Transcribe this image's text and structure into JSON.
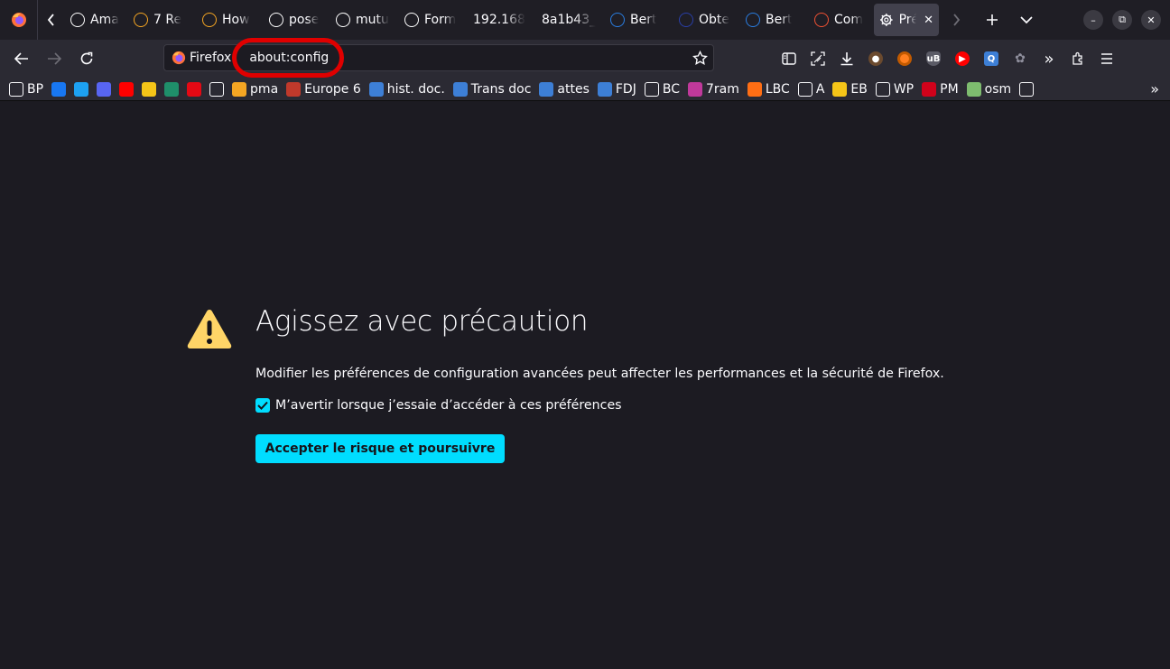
{
  "tabs": [
    {
      "label": "Ama",
      "icon": "amazon-icon",
      "color": "#ffffff"
    },
    {
      "label": "7 Re",
      "icon": "crown-icon",
      "color": "#f5a623"
    },
    {
      "label": "How",
      "icon": "crown-icon",
      "color": "#f5a623"
    },
    {
      "label": "pose",
      "icon": "wiktionary-icon",
      "color": "#ffffff"
    },
    {
      "label": "mutu",
      "icon": "wiktionary-icon",
      "color": "#ffffff"
    },
    {
      "label": "Form",
      "icon": "marianne-icon",
      "color": "#ffffff"
    },
    {
      "label": "192.168",
      "icon": "",
      "color": ""
    },
    {
      "label": "8a1b43_",
      "icon": "",
      "color": ""
    },
    {
      "label": "Bert",
      "icon": "bp-icon",
      "color": "#2a7de1"
    },
    {
      "label": "Obte",
      "icon": "circle-icon",
      "color": "#2a3fa8"
    },
    {
      "label": "Bert",
      "icon": "bp-icon",
      "color": "#2a7de1"
    },
    {
      "label": "Com",
      "icon": "git-icon",
      "color": "#f05133"
    }
  ],
  "active_tab": {
    "label": "Pré",
    "icon": "gear-icon"
  },
  "url": {
    "identity": "Firefox",
    "value": "about:config"
  },
  "bookmarks": [
    {
      "label": "BP",
      "icon": "globe-icon",
      "color": "#ffffff"
    },
    {
      "label": "",
      "icon": "facebook-icon",
      "color": "#1877f2"
    },
    {
      "label": "",
      "icon": "twitter-icon",
      "color": "#1da1f2"
    },
    {
      "label": "",
      "icon": "discord-icon",
      "color": "#5865f2"
    },
    {
      "label": "",
      "icon": "youtube-icon",
      "color": "#ff0000"
    },
    {
      "label": "",
      "icon": "mail-icon",
      "color": "#f5c518"
    },
    {
      "label": "",
      "icon": "g-icon",
      "color": "#1f8f6a"
    },
    {
      "label": "",
      "icon": "netflix-icon",
      "color": "#e50914"
    },
    {
      "label": "",
      "icon": "v-icon",
      "color": "#ffffff"
    },
    {
      "label": "pma",
      "icon": "pma-icon",
      "color": "#f5a623"
    },
    {
      "label": "Europe 6",
      "icon": "europe-icon",
      "color": "#c0392b"
    },
    {
      "label": "hist. doc.",
      "icon": "e-icon",
      "color": "#3d7fd6"
    },
    {
      "label": "Trans doc",
      "icon": "e-icon",
      "color": "#3d7fd6"
    },
    {
      "label": "attes",
      "icon": "e-icon",
      "color": "#3d7fd6"
    },
    {
      "label": "FDJ",
      "icon": "fdj-icon",
      "color": "#3d7fd6"
    },
    {
      "label": "BC",
      "icon": "folder-icon",
      "color": "#ffffff"
    },
    {
      "label": "7ram",
      "icon": "sevenram-icon",
      "color": "#c0399b"
    },
    {
      "label": "LBC",
      "icon": "lbc-icon",
      "color": "#ff6e14"
    },
    {
      "label": "A",
      "icon": "amazon-icon",
      "color": "#ffffff"
    },
    {
      "label": "EB",
      "icon": "eb-icon",
      "color": "#f5c518"
    },
    {
      "label": "WP",
      "icon": "wikipedia-icon",
      "color": "#ffffff"
    },
    {
      "label": "PM",
      "icon": "r-icon",
      "color": "#d0021b"
    },
    {
      "label": "osm",
      "icon": "osm-icon",
      "color": "#7ebc6f"
    },
    {
      "label": "",
      "icon": "google-icon",
      "color": "#ffffff"
    }
  ],
  "warning": {
    "title": "Agissez avec précaution",
    "description": "Modifier les préférences de configuration avancées peut affecter les performances et la sécurité de Firefox.",
    "checkbox_label": "M’avertir lorsque j’essaie d’accéder à ces préférences",
    "checkbox_checked": true,
    "button_label": "Accepter le risque et poursuivre"
  },
  "colors": {
    "accent": "#00ddff",
    "warning": "#ffd567",
    "annotation": "#e00000"
  }
}
